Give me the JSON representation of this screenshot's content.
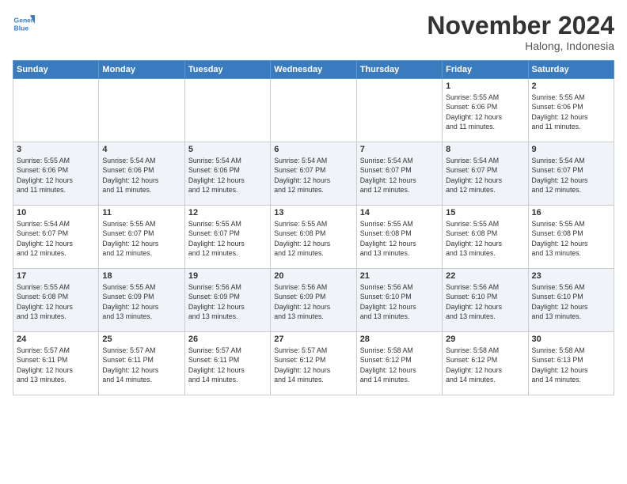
{
  "header": {
    "logo_line1": "General",
    "logo_line2": "Blue",
    "month": "November 2024",
    "location": "Halong, Indonesia"
  },
  "weekdays": [
    "Sunday",
    "Monday",
    "Tuesday",
    "Wednesday",
    "Thursday",
    "Friday",
    "Saturday"
  ],
  "weeks": [
    [
      {
        "day": "",
        "info": ""
      },
      {
        "day": "",
        "info": ""
      },
      {
        "day": "",
        "info": ""
      },
      {
        "day": "",
        "info": ""
      },
      {
        "day": "",
        "info": ""
      },
      {
        "day": "1",
        "info": "Sunrise: 5:55 AM\nSunset: 6:06 PM\nDaylight: 12 hours\nand 11 minutes."
      },
      {
        "day": "2",
        "info": "Sunrise: 5:55 AM\nSunset: 6:06 PM\nDaylight: 12 hours\nand 11 minutes."
      }
    ],
    [
      {
        "day": "3",
        "info": "Sunrise: 5:55 AM\nSunset: 6:06 PM\nDaylight: 12 hours\nand 11 minutes."
      },
      {
        "day": "4",
        "info": "Sunrise: 5:54 AM\nSunset: 6:06 PM\nDaylight: 12 hours\nand 11 minutes."
      },
      {
        "day": "5",
        "info": "Sunrise: 5:54 AM\nSunset: 6:06 PM\nDaylight: 12 hours\nand 12 minutes."
      },
      {
        "day": "6",
        "info": "Sunrise: 5:54 AM\nSunset: 6:07 PM\nDaylight: 12 hours\nand 12 minutes."
      },
      {
        "day": "7",
        "info": "Sunrise: 5:54 AM\nSunset: 6:07 PM\nDaylight: 12 hours\nand 12 minutes."
      },
      {
        "day": "8",
        "info": "Sunrise: 5:54 AM\nSunset: 6:07 PM\nDaylight: 12 hours\nand 12 minutes."
      },
      {
        "day": "9",
        "info": "Sunrise: 5:54 AM\nSunset: 6:07 PM\nDaylight: 12 hours\nand 12 minutes."
      }
    ],
    [
      {
        "day": "10",
        "info": "Sunrise: 5:54 AM\nSunset: 6:07 PM\nDaylight: 12 hours\nand 12 minutes."
      },
      {
        "day": "11",
        "info": "Sunrise: 5:55 AM\nSunset: 6:07 PM\nDaylight: 12 hours\nand 12 minutes."
      },
      {
        "day": "12",
        "info": "Sunrise: 5:55 AM\nSunset: 6:07 PM\nDaylight: 12 hours\nand 12 minutes."
      },
      {
        "day": "13",
        "info": "Sunrise: 5:55 AM\nSunset: 6:08 PM\nDaylight: 12 hours\nand 12 minutes."
      },
      {
        "day": "14",
        "info": "Sunrise: 5:55 AM\nSunset: 6:08 PM\nDaylight: 12 hours\nand 13 minutes."
      },
      {
        "day": "15",
        "info": "Sunrise: 5:55 AM\nSunset: 6:08 PM\nDaylight: 12 hours\nand 13 minutes."
      },
      {
        "day": "16",
        "info": "Sunrise: 5:55 AM\nSunset: 6:08 PM\nDaylight: 12 hours\nand 13 minutes."
      }
    ],
    [
      {
        "day": "17",
        "info": "Sunrise: 5:55 AM\nSunset: 6:08 PM\nDaylight: 12 hours\nand 13 minutes."
      },
      {
        "day": "18",
        "info": "Sunrise: 5:55 AM\nSunset: 6:09 PM\nDaylight: 12 hours\nand 13 minutes."
      },
      {
        "day": "19",
        "info": "Sunrise: 5:56 AM\nSunset: 6:09 PM\nDaylight: 12 hours\nand 13 minutes."
      },
      {
        "day": "20",
        "info": "Sunrise: 5:56 AM\nSunset: 6:09 PM\nDaylight: 12 hours\nand 13 minutes."
      },
      {
        "day": "21",
        "info": "Sunrise: 5:56 AM\nSunset: 6:10 PM\nDaylight: 12 hours\nand 13 minutes."
      },
      {
        "day": "22",
        "info": "Sunrise: 5:56 AM\nSunset: 6:10 PM\nDaylight: 12 hours\nand 13 minutes."
      },
      {
        "day": "23",
        "info": "Sunrise: 5:56 AM\nSunset: 6:10 PM\nDaylight: 12 hours\nand 13 minutes."
      }
    ],
    [
      {
        "day": "24",
        "info": "Sunrise: 5:57 AM\nSunset: 6:11 PM\nDaylight: 12 hours\nand 13 minutes."
      },
      {
        "day": "25",
        "info": "Sunrise: 5:57 AM\nSunset: 6:11 PM\nDaylight: 12 hours\nand 14 minutes."
      },
      {
        "day": "26",
        "info": "Sunrise: 5:57 AM\nSunset: 6:11 PM\nDaylight: 12 hours\nand 14 minutes."
      },
      {
        "day": "27",
        "info": "Sunrise: 5:57 AM\nSunset: 6:12 PM\nDaylight: 12 hours\nand 14 minutes."
      },
      {
        "day": "28",
        "info": "Sunrise: 5:58 AM\nSunset: 6:12 PM\nDaylight: 12 hours\nand 14 minutes."
      },
      {
        "day": "29",
        "info": "Sunrise: 5:58 AM\nSunset: 6:12 PM\nDaylight: 12 hours\nand 14 minutes."
      },
      {
        "day": "30",
        "info": "Sunrise: 5:58 AM\nSunset: 6:13 PM\nDaylight: 12 hours\nand 14 minutes."
      }
    ]
  ]
}
